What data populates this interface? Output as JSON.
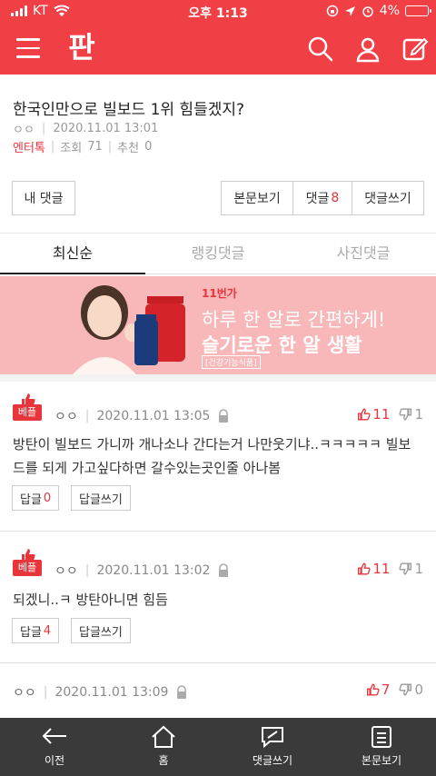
{
  "status": {
    "carrier": "KT",
    "time": "오후 1:13",
    "battery": "4%"
  },
  "header": {
    "logo": "판"
  },
  "article": {
    "title": "한국인만으로 빌보드 1위 힘들겠지?",
    "author": "ㅇㅇ",
    "datetime": "2020.11.01 13:01",
    "category": "엔터톡",
    "views_label": "조회",
    "views": "71",
    "recommend_label": "추천",
    "recommend": "0",
    "my_comments": "내 댓글",
    "view_body": "본문보기",
    "comments_label": "댓글",
    "comments_count": "8",
    "write_comment": "댓글쓰기"
  },
  "tabs": [
    {
      "label": "최신순",
      "active": true
    },
    {
      "label": "랭킹댓글",
      "active": false
    },
    {
      "label": "사진댓글",
      "active": false
    }
  ],
  "ad": {
    "brand": "11번가",
    "line1": "하루 한 알로 간편하게!",
    "line2": "슬기로운 한 알 생활",
    "tag": "[건강기능식품]"
  },
  "comments": [
    {
      "badge": "베플",
      "author": "ㅇㅇ",
      "datetime": "2020.11.01 13:05",
      "up": "11",
      "down": "1",
      "text": "방탄이 빌보드 가니까 개나소나 간다는거 나만웃기냐..ㅋㅋㅋㅋㅋ 빌보드를 되게 가고싶다하면 갈수있는곳인줄 아나봄",
      "reply_label": "답글",
      "reply_count": "0",
      "write_reply": "답글쓰기"
    },
    {
      "badge": "베플",
      "author": "ㅇㅇ",
      "datetime": "2020.11.01 13:02",
      "up": "11",
      "down": "1",
      "text": "되겠니..ㅋ 방탄아니면 힘듬",
      "reply_label": "답글",
      "reply_count": "4",
      "write_reply": "답글쓰기"
    },
    {
      "author": "ㅇㅇ",
      "datetime": "2020.11.01 13:09",
      "up": "7",
      "down": "0"
    }
  ],
  "bottom_nav": [
    {
      "label": "이전",
      "icon": "back-arrow-icon"
    },
    {
      "label": "홈",
      "icon": "home-icon"
    },
    {
      "label": "댓글쓰기",
      "icon": "write-comment-icon"
    },
    {
      "label": "본문보기",
      "icon": "document-icon"
    }
  ],
  "colors": {
    "brand_red": "#f03f45",
    "accent_red": "#e8353c",
    "bottom_bar": "#3a3a3a"
  }
}
